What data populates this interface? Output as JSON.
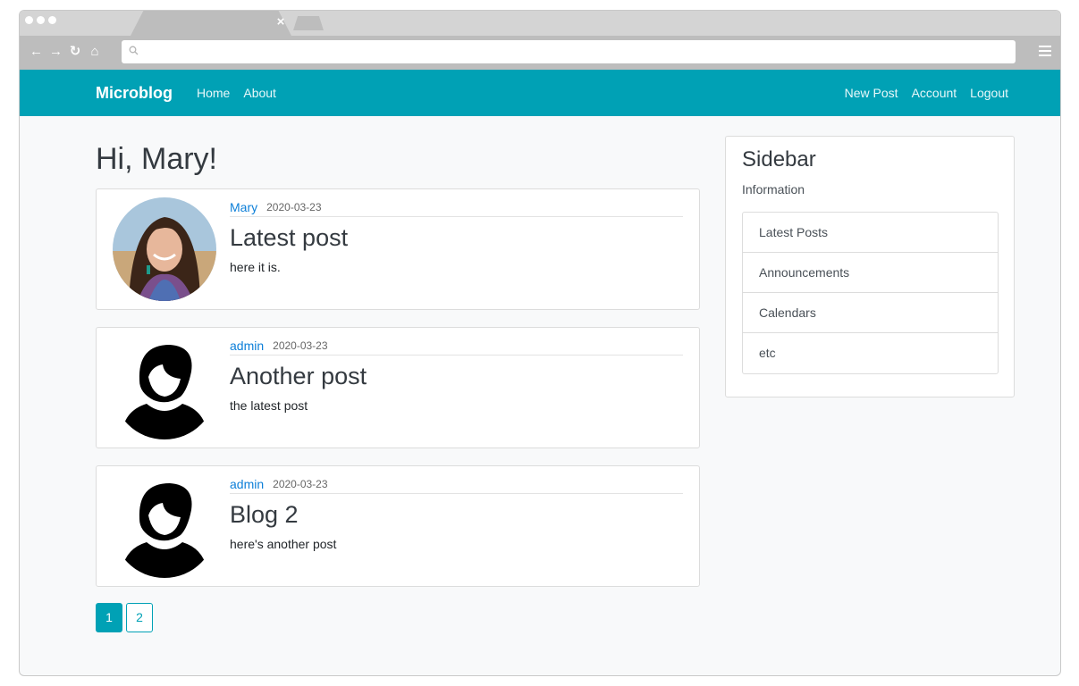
{
  "browser": {
    "address_value": ""
  },
  "site": {
    "brand": "Microblog",
    "nav_left": [
      "Home",
      "About"
    ],
    "nav_right": [
      "New Post",
      "Account",
      "Logout"
    ],
    "accent_color": "#00a1b5"
  },
  "main": {
    "greeting": "Hi, Mary!",
    "posts": [
      {
        "author": "Mary",
        "date": "2020-03-23",
        "title": "Latest post",
        "body": "here it is.",
        "avatar": "photo-avatar"
      },
      {
        "author": "admin",
        "date": "2020-03-23",
        "title": "Another post",
        "body": "the latest post",
        "avatar": "default-avatar"
      },
      {
        "author": "admin",
        "date": "2020-03-23",
        "title": "Blog 2",
        "body": "here's another post",
        "avatar": "default-avatar"
      }
    ],
    "pagination": {
      "pages": [
        "1",
        "2"
      ],
      "active": "1"
    }
  },
  "sidebar": {
    "title": "Sidebar",
    "subtitle": "Information",
    "items": [
      "Latest Posts",
      "Announcements",
      "Calendars",
      "etc"
    ]
  }
}
